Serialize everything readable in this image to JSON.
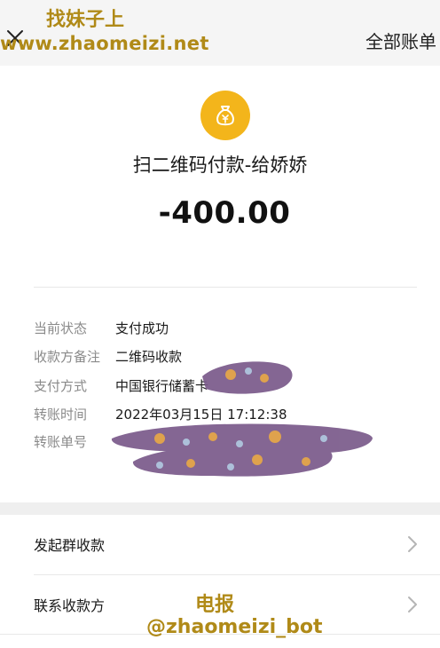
{
  "header": {
    "right_action": "全部账单",
    "close_icon": "close-icon"
  },
  "watermark": {
    "top_title": "找妹子上",
    "top_url": "www.zhaomeizi.net",
    "bottom_title": "电报",
    "bottom_handle": "@zhaomeizi_bot"
  },
  "transaction": {
    "icon": "money-bag-icon",
    "payee": "扫二维码付款-给娇娇",
    "amount": "-400.00"
  },
  "details": [
    {
      "label": "当前状态",
      "value": "支付成功"
    },
    {
      "label": "收款方备注",
      "value": "二维码收款"
    },
    {
      "label": "支付方式",
      "value": "中国银行储蓄卡"
    },
    {
      "label": "转账时间",
      "value": "2022年03月15日 17:12:38"
    },
    {
      "label": "转账单号",
      "value": ""
    }
  ],
  "actions": [
    {
      "label": "发起群收款"
    },
    {
      "label": "联系收款方"
    }
  ],
  "colors": {
    "accent": "#f3b51b",
    "watermark": "#b08a18",
    "redaction": "#7a5a8a"
  }
}
